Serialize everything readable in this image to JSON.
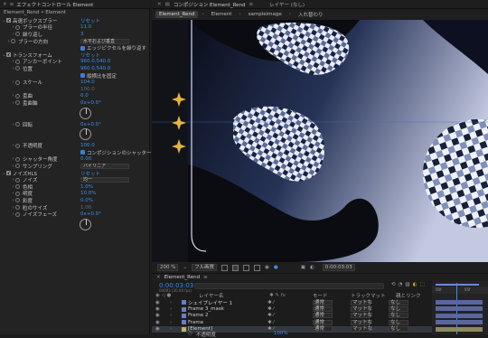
{
  "effect_panel": {
    "title": "エフェクトコントロール Element",
    "subtitle": "Element_Rend • Element",
    "rows": [
      {
        "label": "高速ボックスブラー",
        "value": "リセット",
        "kind": "group",
        "indent": 0
      },
      {
        "label": "ブラーの半径",
        "value": "11.0",
        "kind": "num",
        "indent": 2
      },
      {
        "label": "繰り返し",
        "value": "3",
        "kind": "num",
        "indent": 2
      },
      {
        "label": "ブラーの方向",
        "value": "水平および垂直",
        "kind": "select",
        "indent": 1
      },
      {
        "label": "",
        "value": "エッジピクセルを繰り返す",
        "kind": "check",
        "indent": 1
      },
      {
        "label": "トランスフォーム",
        "value": "リセット",
        "kind": "group",
        "indent": 0
      },
      {
        "label": "アンカーポイント",
        "value": "960.0,540.0",
        "kind": "num",
        "indent": 2
      },
      {
        "label": "位置",
        "value": "960.0,540.0",
        "kind": "num",
        "indent": 2
      },
      {
        "label": "",
        "value": "縦横比を固定",
        "kind": "check",
        "indent": 1
      },
      {
        "label": "スケール",
        "value": "104.0",
        "kind": "num",
        "indent": 2
      },
      {
        "label": "",
        "value": "100.0",
        "kind": "dim",
        "indent": 2
      },
      {
        "label": "歪曲",
        "value": "0.0",
        "kind": "num",
        "indent": 2
      },
      {
        "label": "歪曲軸",
        "value": "0x+0.0°",
        "kind": "num",
        "indent": 2
      },
      {
        "label": "",
        "value": "",
        "kind": "dial",
        "indent": 0
      },
      {
        "label": "回転",
        "value": "0x+0.0°",
        "kind": "num",
        "indent": 2
      },
      {
        "label": "",
        "value": "",
        "kind": "dial",
        "indent": 0
      },
      {
        "label": "不透明度",
        "value": "100.0",
        "kind": "num",
        "indent": 2
      },
      {
        "label": "",
        "value": "コンポジションのシャッター角度を使",
        "kind": "check",
        "indent": 1
      },
      {
        "label": "シャッター角度",
        "value": "0.00",
        "kind": "num",
        "indent": 2
      },
      {
        "label": "サンプリング",
        "value": "バイリニア",
        "kind": "select",
        "indent": 2
      },
      {
        "label": "ノイズHLS",
        "value": "リセット",
        "kind": "group",
        "indent": 0
      },
      {
        "label": "ノイズ",
        "value": "均一",
        "kind": "select",
        "indent": 2
      },
      {
        "label": "色相",
        "value": "1.0%",
        "kind": "num",
        "indent": 2
      },
      {
        "label": "明度",
        "value": "10.0%",
        "kind": "num",
        "indent": 2
      },
      {
        "label": "彩度",
        "value": "0.0%",
        "kind": "num",
        "indent": 2
      },
      {
        "label": "粒のサイズ",
        "value": "1.00",
        "kind": "dim",
        "indent": 2
      },
      {
        "label": "ノイズフェーズ",
        "value": "0x+0.0°",
        "kind": "num",
        "indent": 2
      },
      {
        "label": "",
        "value": "",
        "kind": "dial",
        "indent": 0
      }
    ]
  },
  "comp_panel": {
    "title": "コンポジション Element_Rend",
    "layer_title": "レイヤー (なし)",
    "tabs": [
      "Element_Rend",
      "Element",
      "sampleimage",
      "入れ替わり"
    ],
    "zoom": "200 %",
    "quality": "フル画質",
    "timecode": "0:00:03:03"
  },
  "timeline": {
    "tab": "Element_Rend",
    "time": "0:00:03:03",
    "fps": "00093 (30.00 fps)",
    "columns": {
      "name": "レイヤー名",
      "mode": "モード",
      "track": "トラックマット",
      "parent": "親とリンク"
    },
    "layers": [
      {
        "num": "",
        "name": "シェイプレイヤー 1",
        "mode": "通常",
        "track": "マットな",
        "parent": "なし",
        "color": "#6c7ec0"
      },
      {
        "num": "",
        "name": "Frame 3_mask",
        "mode": "通常",
        "track": "マットな",
        "parent": "なし",
        "color": "#6c7ec0"
      },
      {
        "num": "",
        "name": "Frame 2",
        "mode": "通常",
        "track": "マットな",
        "parent": "なし",
        "color": "#6c7ec0"
      },
      {
        "num": "",
        "name": "Frame",
        "mode": "通常",
        "track": "マットな",
        "parent": "なし",
        "color": "#6c7ec0"
      },
      {
        "num": "",
        "name": "[Element]",
        "mode": "通常",
        "track": "マットな",
        "parent": "なし",
        "color": "#b9b76a"
      }
    ],
    "sub_row": {
      "label": "不透明度",
      "value": "100%"
    },
    "ruler": [
      "00f",
      "05f"
    ]
  }
}
